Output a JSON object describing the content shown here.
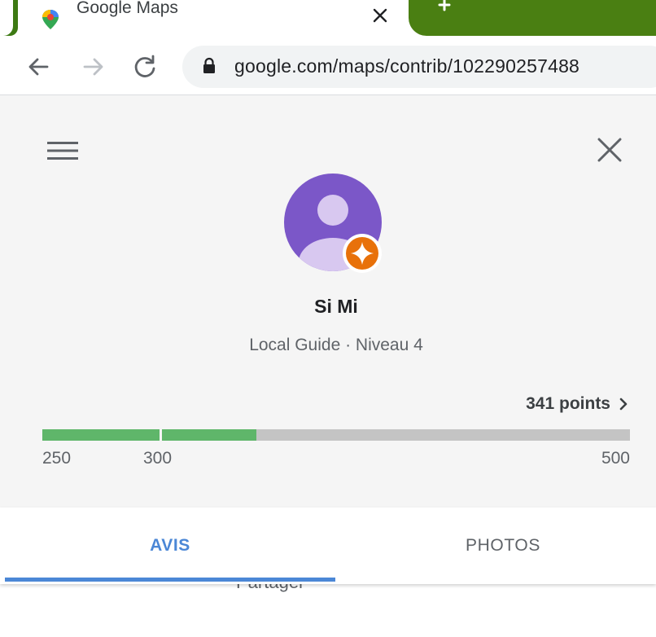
{
  "browser": {
    "tab": {
      "title": "Google Maps"
    },
    "url": "google.com/maps/contrib/102290257488",
    "colors": {
      "tab_green": "#4a7f12"
    }
  },
  "profile": {
    "name": "Si Mi",
    "level": "Local Guide · Niveau 4",
    "points_label": "341 points",
    "points": 341,
    "progress": {
      "min": 250,
      "mid": 300,
      "max": 500,
      "labels": [
        "250",
        "300",
        "500"
      ]
    },
    "colors": {
      "avatar": "#7b57c8",
      "avatar_figure": "#d8c8f0",
      "badge": "#e8710a",
      "progress_fill": "#5fb66a",
      "progress_track": "#c4c4c4"
    }
  },
  "tabs": [
    {
      "label": "AVIS",
      "active": true
    },
    {
      "label": "PHOTOS",
      "active": false
    }
  ],
  "peek": {
    "share_label": "Partager"
  },
  "accent": "#4b87d6"
}
